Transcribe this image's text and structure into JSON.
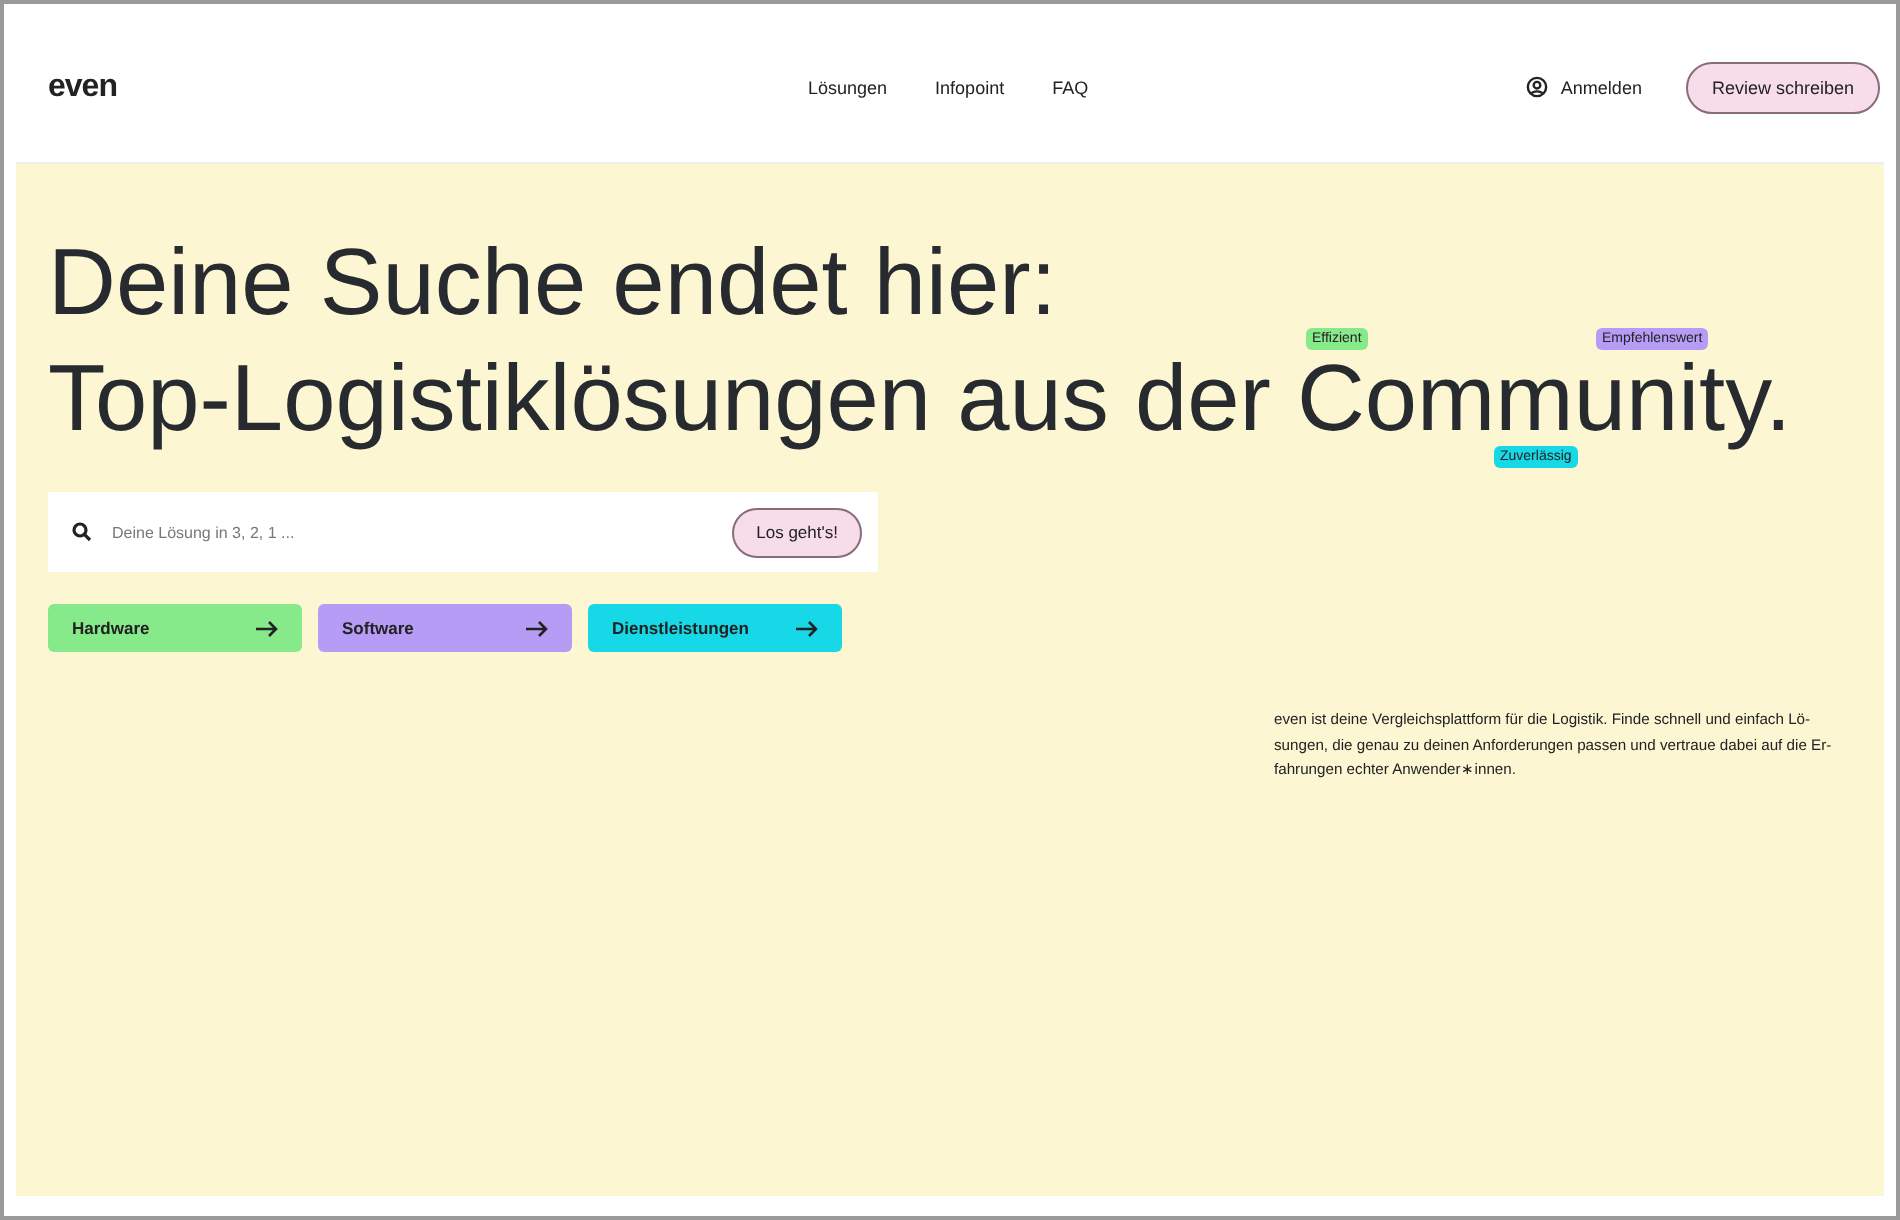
{
  "header": {
    "logo": "even",
    "nav": [
      {
        "label": "Lösungen"
      },
      {
        "label": "Infopoint"
      },
      {
        "label": "FAQ"
      }
    ],
    "login": "Anmelden",
    "cta": "Review schreiben"
  },
  "hero": {
    "headline": [
      "Deine Suche endet hier:",
      "Top-Logistiklösungen aus der Community."
    ],
    "tags": [
      {
        "label": "Effizient",
        "color": "#86e98a"
      },
      {
        "label": "Empfehlenswert",
        "color": "#b79cf5"
      },
      {
        "label": "Zuverlässig",
        "color": "#16d8e6"
      }
    ],
    "search": {
      "placeholder": "Deine Lösung in 3, 2, 1 ...",
      "button": "Los geht's!"
    },
    "categories": [
      {
        "label": "Hardware",
        "color": "#86e98a"
      },
      {
        "label": "Software",
        "color": "#b79cf5"
      },
      {
        "label": "Dienstleistungen",
        "color": "#16d8e6"
      }
    ],
    "intro": [
      "even ist deine Vergleichsplattform für die Logistik. Finde schnell und einfach Lö-",
      "sungen, die genau zu deinen Anforderungen passen und vertraue dabei auf die Er-",
      "fahrungen echter Anwender∗innen."
    ]
  }
}
